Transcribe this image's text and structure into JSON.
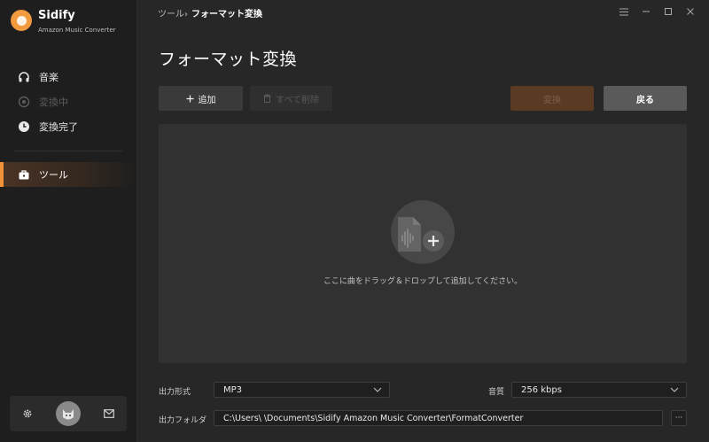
{
  "app": {
    "name": "Sidify",
    "subtitle": "Amazon Music Converter"
  },
  "sidebar": {
    "items": [
      {
        "label": "音楽",
        "icon": "headphones-icon",
        "state": "normal"
      },
      {
        "label": "変換中",
        "icon": "converting-icon",
        "state": "disabled"
      },
      {
        "label": "変換完了",
        "icon": "clock-icon",
        "state": "normal"
      },
      {
        "label": "ツール",
        "icon": "toolbox-icon",
        "state": "active"
      }
    ],
    "bottom": {
      "settings_icon": "gear-icon",
      "avatar_icon": "avatar-icon",
      "mail_icon": "mail-icon"
    }
  },
  "header": {
    "breadcrumb_parent": "ツール",
    "breadcrumb_sep": "›",
    "breadcrumb_current": "フォーマット変換"
  },
  "page": {
    "title": "フォーマット変換"
  },
  "toolbar": {
    "add_label": "追加",
    "clear_label": "すべて削除",
    "convert_label": "変換",
    "back_label": "戻る"
  },
  "dropzone": {
    "hint": "ここに曲をドラッグ＆ドロップして追加してください。"
  },
  "settings": {
    "format_label": "出力形式",
    "format_value": "MP3",
    "quality_label": "音質",
    "quality_value": "256 kbps",
    "folder_label": "出力フォルダ",
    "folder_value": "C:\\Users\\      \\Documents\\Sidify Amazon Music Converter\\FormatConverter",
    "more_label": "···"
  },
  "colors": {
    "accent": "#f1913a",
    "background": "#272727",
    "sidebar": "#1e1e1e"
  }
}
